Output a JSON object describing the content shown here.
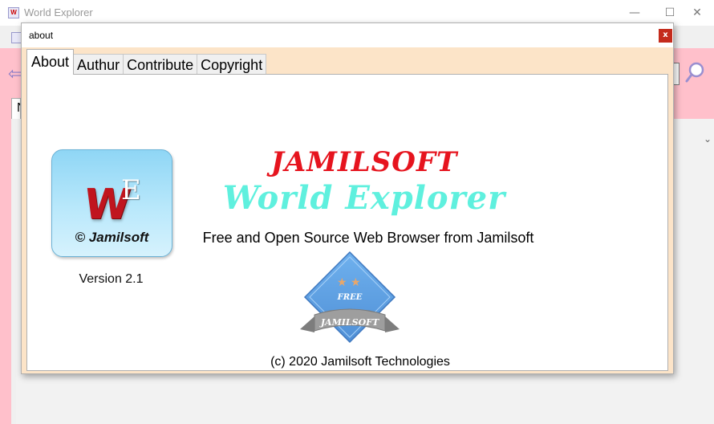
{
  "main_window": {
    "title": "World Explorer",
    "app_icon_letter": "W",
    "controls": {
      "minimize": "—",
      "maximize": "☐",
      "close": "✕"
    },
    "tab_stub": "N",
    "back_icon": "back-arrow-icon",
    "search_icon": "magnifier-icon"
  },
  "dialog": {
    "title": "about",
    "close_label": "x",
    "tabs": [
      {
        "label": "About",
        "active": true
      },
      {
        "label": "Authur",
        "active": false
      },
      {
        "label": "Contribute",
        "active": false
      },
      {
        "label": "Copyright",
        "active": false
      }
    ],
    "about": {
      "logo": {
        "big_letter": "W",
        "small_letter": "E",
        "caption": "© Jamilsoft"
      },
      "version": "Version 2.1",
      "brand": "JAMILSOFT",
      "product": "World Explorer",
      "tagline": "Free and Open Source Web Browser from Jamilsoft",
      "badge": {
        "top_text": "FREE",
        "ribbon_text": "JAMILSOFT",
        "stars": "★ ★"
      },
      "footer": "(c) 2020 Jamilsoft Technologies"
    }
  },
  "colors": {
    "toolbar_pink": "#ffc0cb",
    "dialog_peach": "#fce4c8",
    "brand_red": "#e6141e",
    "product_cyan": "#5ff0de",
    "logo_blue": "#8fd6f5",
    "close_red": "#c42b1c"
  }
}
